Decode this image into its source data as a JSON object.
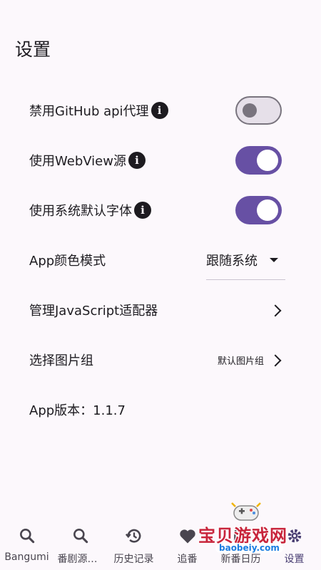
{
  "header": {
    "title": "设置"
  },
  "settings": {
    "disable_github_proxy": {
      "label": "禁用GitHub api代理",
      "enabled": false
    },
    "use_webview_source": {
      "label": "使用WebView源",
      "enabled": true
    },
    "use_system_font": {
      "label": "使用系统默认字体",
      "enabled": true
    },
    "color_mode": {
      "label": "App颜色模式",
      "value": "跟随系统"
    },
    "manage_js_adapters": {
      "label": "管理JavaScript适配器"
    },
    "select_image_group": {
      "label": "选择图片组",
      "value": "默认图片组"
    },
    "app_version": {
      "label": "App版本：1.1.7"
    }
  },
  "nav": {
    "items": [
      {
        "label": "Bangumi",
        "icon": "search-icon"
      },
      {
        "label": "番剧源搜索",
        "icon": "search-icon"
      },
      {
        "label": "历史记录",
        "icon": "history-icon"
      },
      {
        "label": "追番",
        "icon": "heart-icon"
      },
      {
        "label": "新番日历",
        "icon": "calendar-icon"
      },
      {
        "label": "设置",
        "icon": "gear-icon"
      }
    ],
    "active_index": 5
  },
  "watermark": {
    "text": "宝贝游戏网",
    "url": "baobeiy.com"
  },
  "colors": {
    "background": "#fcf8fc",
    "accent": "#6750a4",
    "switch_off_track": "#e6e0e9",
    "switch_off_outline": "#79747e"
  }
}
